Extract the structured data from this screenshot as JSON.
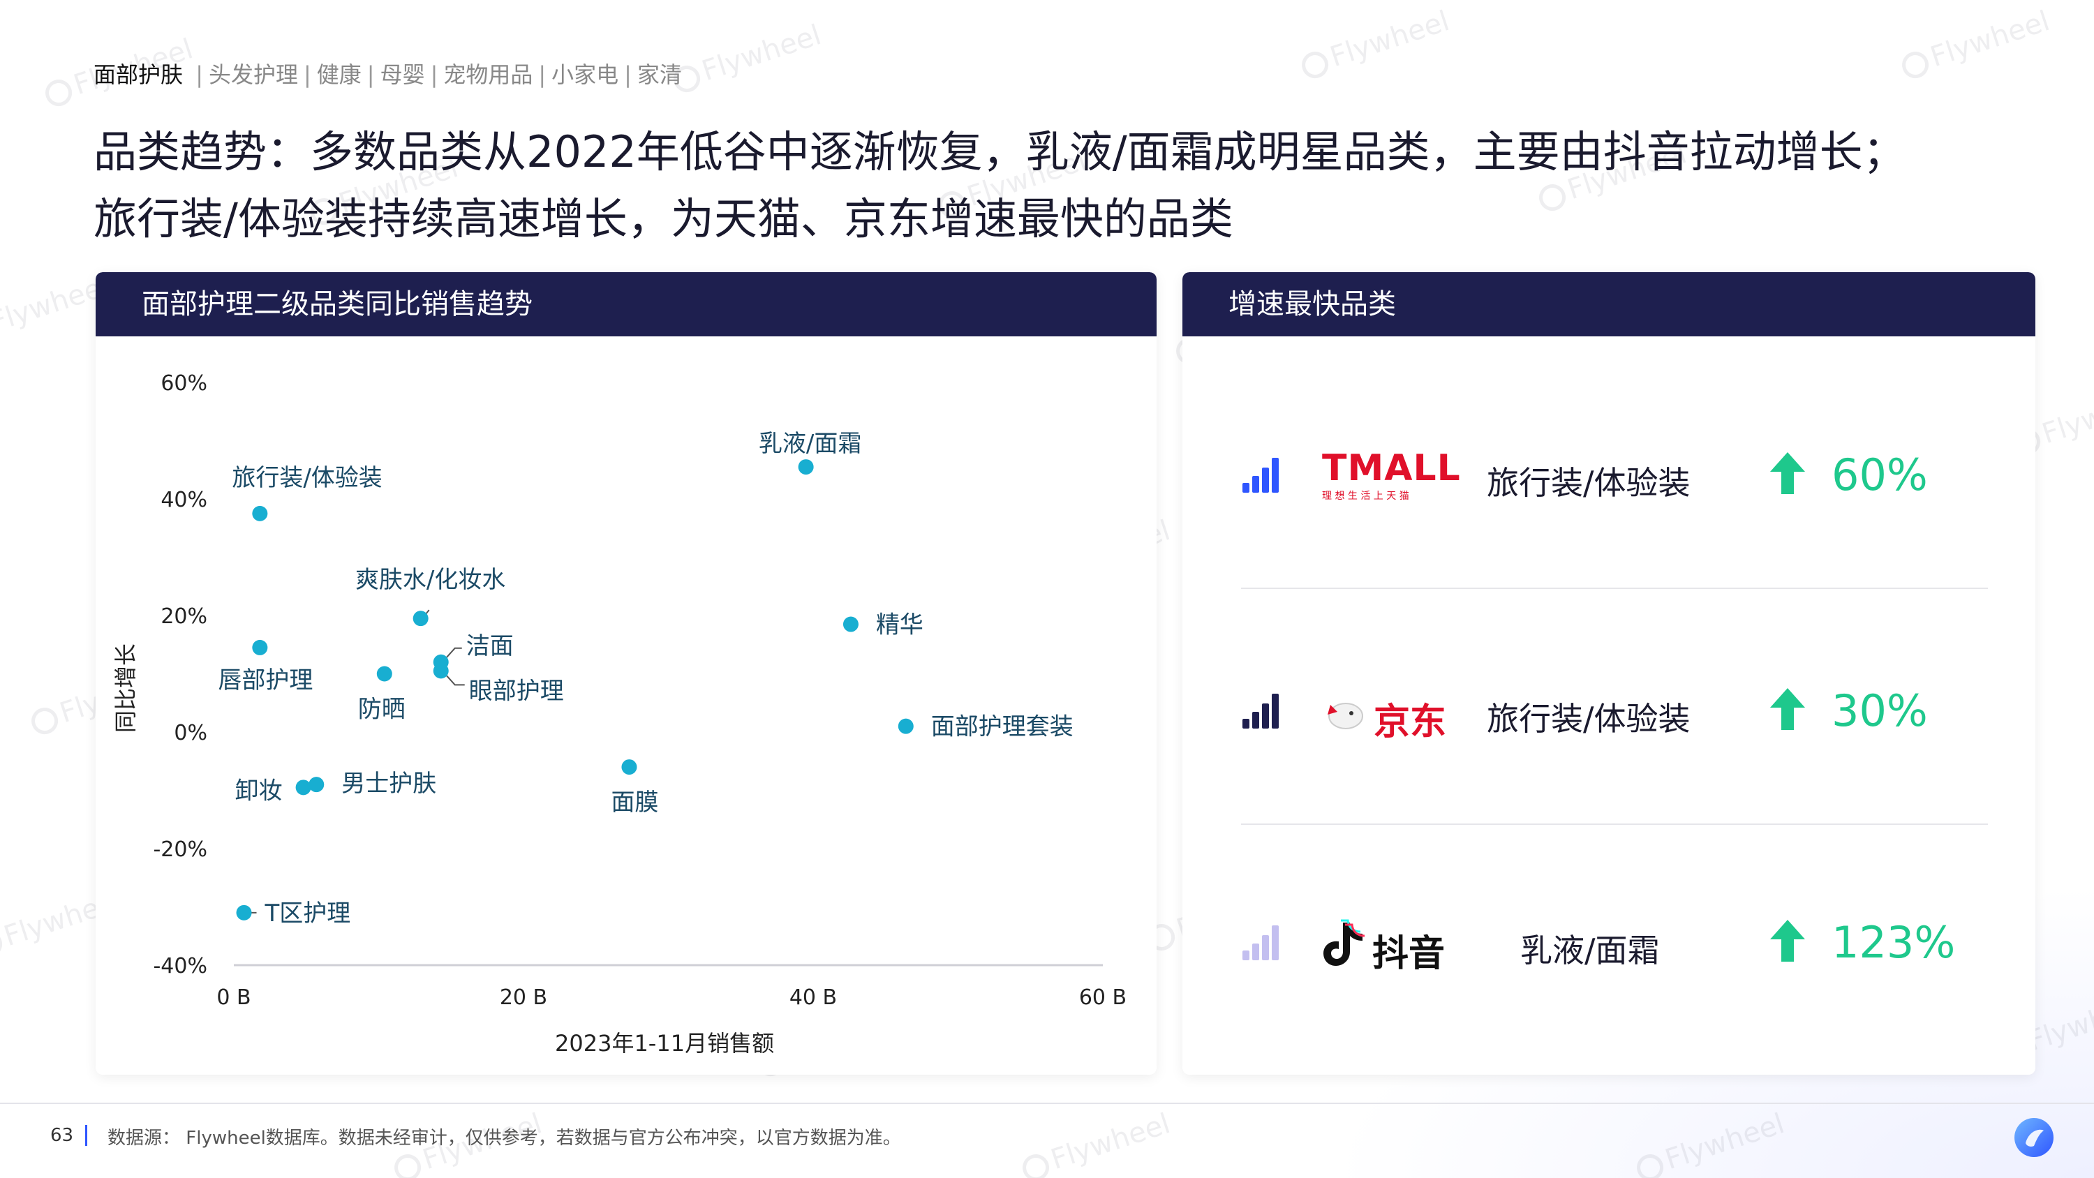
{
  "nav": {
    "active": "面部护肤",
    "items": [
      "头发护理",
      "健康",
      "母婴",
      "宠物用品",
      "小家电",
      "家清"
    ],
    "separator": "|"
  },
  "title": {
    "line1": "品类趋势：多数品类从2022年低谷中逐渐恢复，乳液/面霜成明星品类，主要由抖音拉动增长；",
    "line2": "旅行装/体验装持续高速增长，为天猫、京东增速最快的品类"
  },
  "watermark": "Flywheel",
  "left_panel": {
    "title": "面部护理二级品类同比销售趋势"
  },
  "chart_data": {
    "type": "scatter",
    "xlabel": "2023年1-11月销售额",
    "ylabel": "同比增长",
    "xlim": [
      0,
      60
    ],
    "ylim": [
      -40,
      60
    ],
    "x_ticks": [
      "0 B",
      "20 B",
      "40 B",
      "60 B"
    ],
    "y_ticks": [
      "60%",
      "40%",
      "20%",
      "0%",
      "-20%",
      "-40%"
    ],
    "point_color": "#18aed1",
    "points": [
      {
        "label": "旅行装/体验装",
        "x": 1.8,
        "y": 37.5
      },
      {
        "label": "乳液/面霜",
        "x": 39.5,
        "y": 45.5
      },
      {
        "label": "爽肤水/化妆水",
        "x": 12.9,
        "y": 19.5
      },
      {
        "label": "唇部护理",
        "x": 1.8,
        "y": 14.5
      },
      {
        "label": "洁面",
        "x": 14.3,
        "y": 12.0
      },
      {
        "label": "眼部护理",
        "x": 14.3,
        "y": 10.5
      },
      {
        "label": "防晒",
        "x": 10.4,
        "y": 10.0
      },
      {
        "label": "精华",
        "x": 42.6,
        "y": 18.5
      },
      {
        "label": "面部护理套装",
        "x": 46.4,
        "y": 1.0
      },
      {
        "label": "面膜",
        "x": 27.3,
        "y": -6.0
      },
      {
        "label": "卸妆",
        "x": 4.8,
        "y": -9.5
      },
      {
        "label": "男士护肤",
        "x": 5.7,
        "y": -9.0
      },
      {
        "label": "T区护理",
        "x": 0.7,
        "y": -31.0
      }
    ]
  },
  "right_panel": {
    "title": "增速最快品类",
    "rows": [
      {
        "platform": "TMALL",
        "platform_sub": "理 想 生 活 上 天 猫",
        "category": "旅行装/体验装",
        "growth": "60%",
        "growth_value": 60,
        "bar_color": "#2f56ff"
      },
      {
        "platform": "京东",
        "category": "旅行装/体验装",
        "growth": "30%",
        "growth_value": 30,
        "bar_color": "#1e1f4f"
      },
      {
        "platform": "抖音",
        "category": "乳液/面霜",
        "growth": "123%",
        "growth_value": 123,
        "bar_color": "#c3bff0"
      }
    ],
    "accent_green": "#1ec88c"
  },
  "footer": {
    "page": "63",
    "source": "数据源： Flywheel数据库。数据未经审计，仅供参考，若数据与官方公布冲突，以官方数据为准。"
  }
}
